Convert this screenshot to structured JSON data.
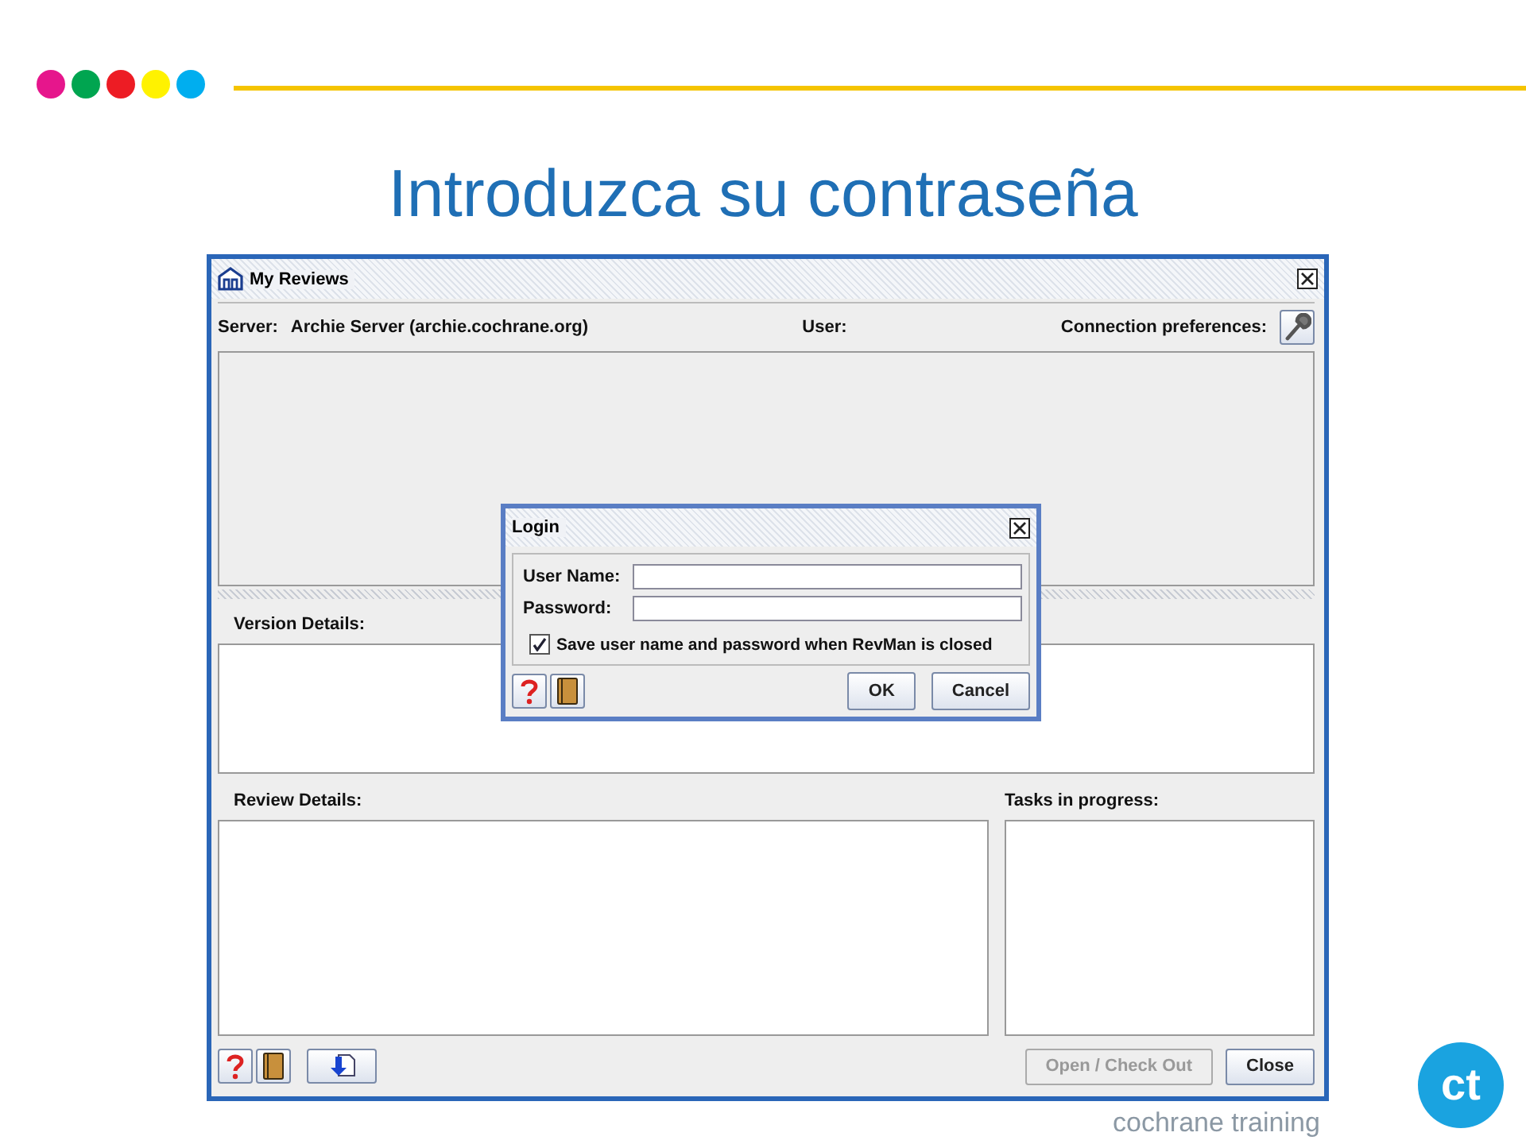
{
  "slide": {
    "dots": [
      {
        "color": "#e6168c"
      },
      {
        "color": "#00a550"
      },
      {
        "color": "#ed1c24"
      },
      {
        "color": "#fff200"
      },
      {
        "color": "#00aeef"
      }
    ],
    "title": "Introduzca su contraseña",
    "footer_text": "cochrane training",
    "logo_text": "ct"
  },
  "window": {
    "title": "My Reviews",
    "server_label": "Server:",
    "server_value": "Archie Server (archie.cochrane.org)",
    "user_label": "User:",
    "connection_label": "Connection preferences:",
    "version_details_label": "Version Details:",
    "review_details_label": "Review Details:",
    "tasks_label": "Tasks in progress:",
    "buttons": [
      {
        "label": "Open / Check Out",
        "disabled": true
      },
      {
        "label": "Close",
        "disabled": false
      }
    ]
  },
  "login": {
    "title": "Login",
    "fields": [
      {
        "label": "User Name:"
      },
      {
        "label": "Password:"
      }
    ],
    "save_checkbox": {
      "label": "Save user name and password when RevMan is closed",
      "checked": true
    },
    "buttons": [
      {
        "label": "OK"
      },
      {
        "label": "Cancel"
      }
    ]
  }
}
